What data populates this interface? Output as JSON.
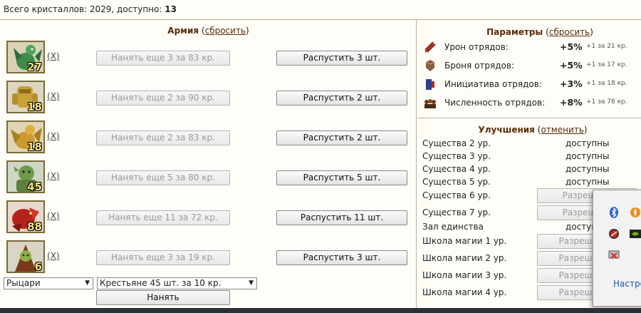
{
  "header": {
    "crystals_prefix": "Всего кристаллов: 2029, доступно: ",
    "crystals_available": "13"
  },
  "army": {
    "title": "Армия",
    "reset_label": "сбросить",
    "units": [
      {
        "count": "27",
        "x_label": "X",
        "hire_label": "Нанять еще 3 за 83 кр.",
        "dismiss_label": "Распустить 3 шт.",
        "icon": "green-dragon-icon"
      },
      {
        "count": "18",
        "x_label": "X",
        "hire_label": "Нанять еще 2 за 90 кр.",
        "dismiss_label": "Распустить 2 шт.",
        "icon": "gold-golem-icon"
      },
      {
        "count": "18",
        "x_label": "X",
        "hire_label": "Нанять еще 2 за 83 кр.",
        "dismiss_label": "Распустить 2 шт.",
        "icon": "gold-dragon-icon"
      },
      {
        "count": "45",
        "x_label": "X",
        "hire_label": "Нанять еще 5 за 80 кр.",
        "dismiss_label": "Распустить 5 шт.",
        "icon": "orc-icon"
      },
      {
        "count": "88",
        "x_label": "X",
        "hire_label": "Нанять еще 11 за 72 кр.",
        "dismiss_label": "Распустить 11 шт.",
        "icon": "red-hound-icon"
      },
      {
        "count": "6",
        "x_label": "X",
        "hire_label": "Нанять еще 3 за 19 кр.",
        "dismiss_label": "Распустить 3 шт.",
        "icon": "goblin-shaman-icon"
      }
    ],
    "faction_select": "Рыцари",
    "unit_select": "Крестьяне 45 шт. за 10 кр.",
    "hire_button": "Нанять"
  },
  "params": {
    "title": "Параметры",
    "reset_label": "сбросить",
    "rows": [
      {
        "label": "Урон отрядов:",
        "value": "+5%",
        "note": "+1 за 21 кр.",
        "icon": "damage-icon"
      },
      {
        "label": "Броня отрядов:",
        "value": "+5%",
        "note": "+1 за 17 кр.",
        "icon": "armor-icon"
      },
      {
        "label": "Инициатива отрядов:",
        "value": "+3%",
        "note": "+1 за 18 кр.",
        "icon": "initiative-icon"
      },
      {
        "label": "Численность отрядов:",
        "value": "+8%",
        "note": "+1 за 78 кр.",
        "icon": "troop-count-icon"
      }
    ]
  },
  "upgrades": {
    "title": "Улучшения",
    "cancel_label": "отменить",
    "rows": [
      {
        "label": "Существа 2 ур.",
        "status": "доступны"
      },
      {
        "label": "Существа 3 ур.",
        "status": "доступны"
      },
      {
        "label": "Существа 4 ур.",
        "status": "доступны"
      },
      {
        "label": "Существа 5 ур.",
        "status": "доступны"
      },
      {
        "label": "Существа 6 ур.",
        "button": "Разрешить"
      },
      {
        "label": "Существа 7 ур.",
        "button": "Разрешить"
      },
      {
        "label": "Зал единства",
        "status": "доступ"
      },
      {
        "label": "Школа магии 1 ур.",
        "button": "Разрешить з"
      },
      {
        "label": "Школа магии 2 ур.",
        "button": "Разрешить з"
      },
      {
        "label": "Школа магии 3 ур.",
        "button": "Разрешить з"
      },
      {
        "label": "Школа магии 4 ур.",
        "button": "Разрешить з"
      }
    ]
  },
  "tray": {
    "link": "Настро",
    "icons": [
      "bluetooth-icon",
      "avast-icon",
      "red-circle-app-icon",
      "nvidia-icon",
      "network-warning-icon"
    ]
  }
}
